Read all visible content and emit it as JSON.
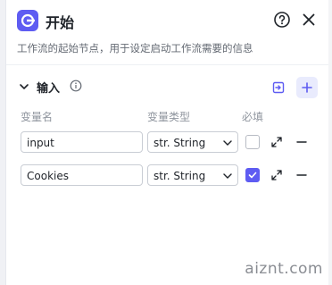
{
  "node": {
    "title": "开始",
    "description": "工作流的起始节点，用于设定启动工作流需要的信息",
    "icon": "start-node-icon"
  },
  "header_actions": {
    "help_icon": "help-circle-icon",
    "close_icon": "close-icon"
  },
  "input_section": {
    "title": "输入",
    "info_icon": "info-icon",
    "import_icon": "import-icon",
    "add_icon": "plus-icon",
    "columns": {
      "name": "变量名",
      "type": "变量类型",
      "required": "必填"
    },
    "rows": [
      {
        "name": "input",
        "type": "str. String",
        "required": false
      },
      {
        "name": "Cookies",
        "type": "str. String",
        "required": true
      }
    ]
  },
  "colors": {
    "accent": "#5e5cf2",
    "accent_soft": "#e9ebfd",
    "text": "#1f2329",
    "muted": "#646a73"
  },
  "watermark": "aiznt.com"
}
